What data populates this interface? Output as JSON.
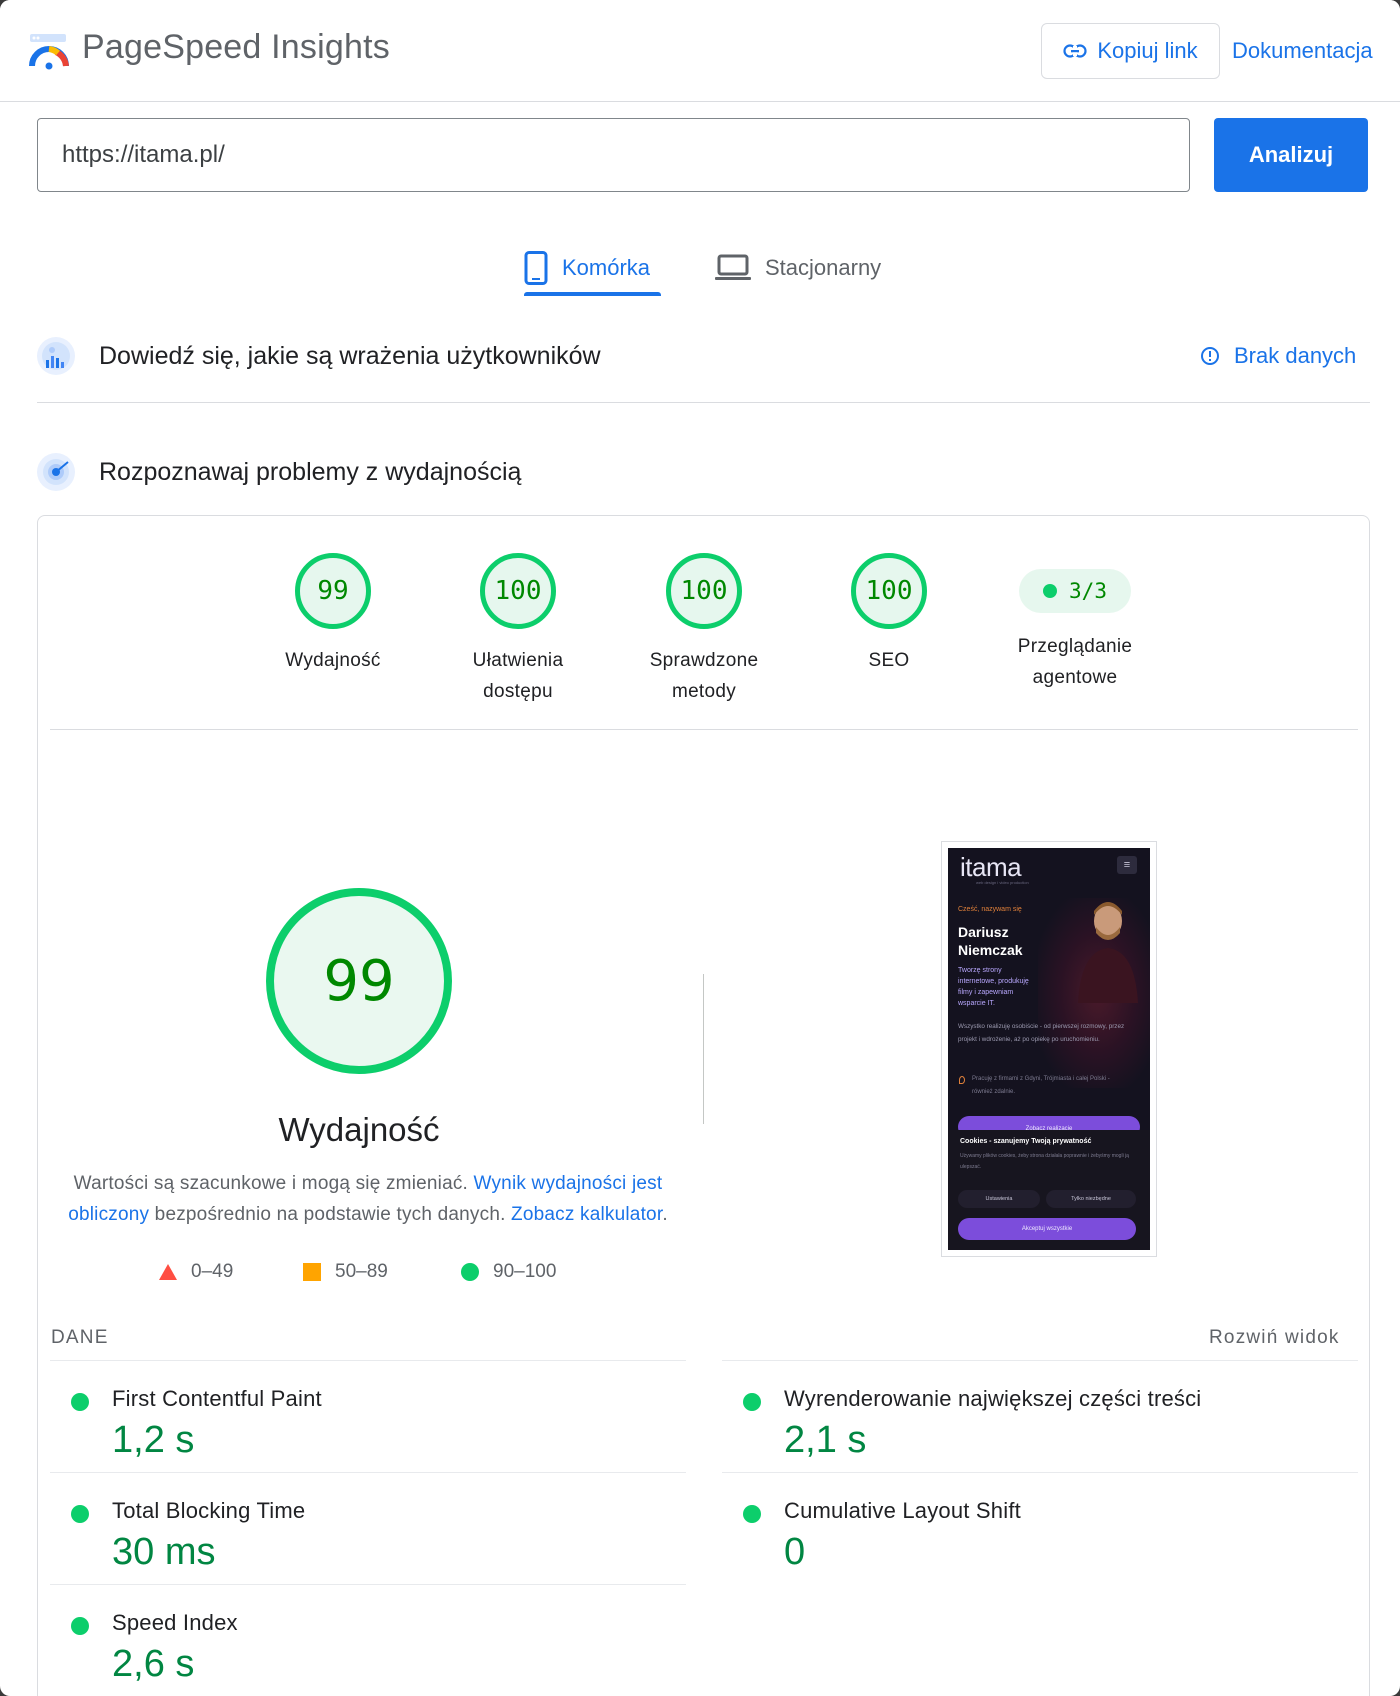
{
  "header": {
    "app_title": "PageSpeed Insights",
    "copy_link_label": "Kopiuj link",
    "docs_label": "Dokumentacja"
  },
  "url_bar": {
    "value": "https://itama.pl/",
    "analyze_label": "Analizuj"
  },
  "tabs": [
    {
      "label": "Komórka",
      "active": true
    },
    {
      "label": "Stacjonarny",
      "active": false
    }
  ],
  "sections": {
    "user_experience_title": "Dowiedź się, jakie są wrażenia użytkowników",
    "no_data_label": "Brak danych",
    "diagnose_title": "Rozpoznawaj problemy z wydajnością"
  },
  "scores": [
    {
      "value": "99",
      "label_line1": "Wydajność",
      "label_line2": ""
    },
    {
      "value": "100",
      "label_line1": "Ułatwienia",
      "label_line2": "dostępu"
    },
    {
      "value": "100",
      "label_line1": "Sprawdzone",
      "label_line2": "metody"
    },
    {
      "value": "100",
      "label_line1": "SEO",
      "label_line2": ""
    }
  ],
  "agentic": {
    "value": "3/3",
    "label_line1": "Przeglądanie",
    "label_line2": "agentowe"
  },
  "performance": {
    "score": "99",
    "label": "Wydajność",
    "desc_part1": "Wartości są szacunkowe i mogą się zmieniać. ",
    "desc_link1": "Wynik wydajności jest obliczony",
    "desc_part2": " bezpośrednio na podstawie tych danych. ",
    "desc_link2": "Zobacz kalkulator",
    "desc_end": "."
  },
  "legend": {
    "poor": "0–49",
    "average": "50–89",
    "good": "90–100"
  },
  "colors": {
    "good": "#0cce6b",
    "average": "#ffa400",
    "poor": "#ff4e42",
    "accent": "#1a73e8"
  },
  "thumbnail": {
    "logo": "itama",
    "tagline": "web design i video production",
    "hello": "Cześć, nazywam się",
    "name_line1": "Dariusz",
    "name_line2": "Niemczak",
    "subtitle": "Tworzę strony internetowe, produkuję filmy i zapewniam wsparcie IT.",
    "body": "Wszystko realizuję osobiście - od pierwszej rozmowy, przez projekt i wdrożenie, aż po opiekę po uruchomieniu.",
    "location": "Pracuję z firmami z Gdyni, Trójmiasta i całej Polski - również zdalnie.",
    "cta": "Zobacz realizacje",
    "cookie_title": "Cookies - szanujemy Twoją prywatność",
    "cookie_text": "Używamy plików cookies, żeby strona działała poprawnie i żebyśmy mogli ją ulepszać.",
    "cookie_settings": "Ustawienia",
    "cookie_necessary": "Tylko niezbędne",
    "cookie_accept": "Akceptuj wszystkie"
  },
  "metrics": {
    "section_label": "DANE",
    "expand_label": "Rozwiń widok",
    "items": [
      {
        "name": "First Contentful Paint",
        "value": "1,2 s"
      },
      {
        "name": "Wyrenderowanie największej części treści",
        "value": "2,1 s"
      },
      {
        "name": "Total Blocking Time",
        "value": "30 ms"
      },
      {
        "name": "Cumulative Layout Shift",
        "value": "0"
      },
      {
        "name": "Speed Index",
        "value": "2,6 s"
      }
    ]
  }
}
